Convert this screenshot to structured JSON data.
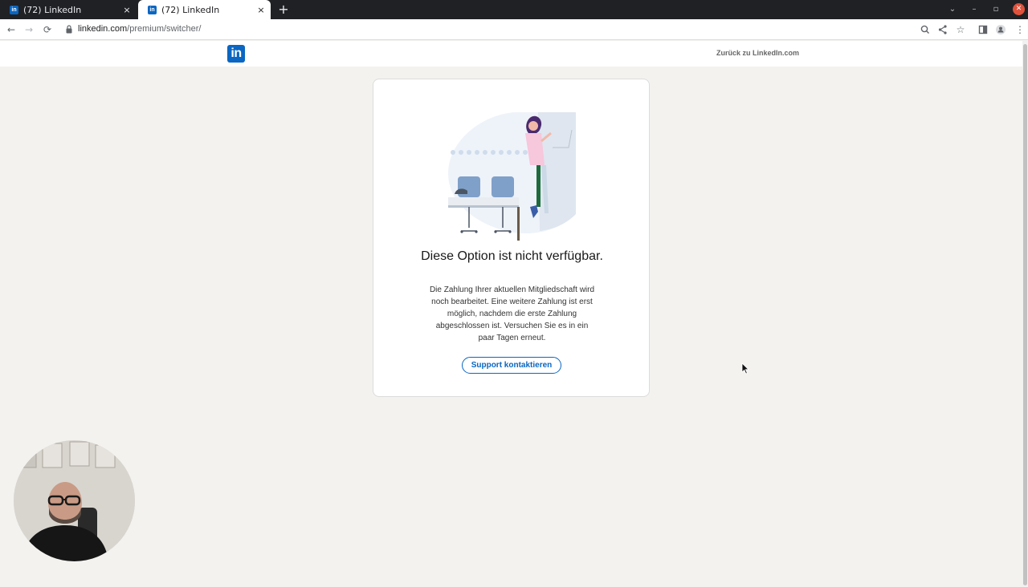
{
  "browser": {
    "tabs": [
      {
        "title": "(72) LinkedIn",
        "favicon": "in",
        "close": "×"
      },
      {
        "title": "(72) LinkedIn",
        "favicon": "in",
        "close": "×"
      }
    ],
    "new_tab": "+",
    "url_domain": "linkedin.com",
    "url_path": "/premium/switcher/"
  },
  "header": {
    "logo": "in",
    "back_link": "Zurück zu LinkedIn.com"
  },
  "dialog": {
    "title": "Diese Option ist nicht verfügbar.",
    "message": "Die Zahlung Ihrer aktuellen Mitgliedschaft wird noch bearbeitet. Eine weitere Zahlung ist erst möglich, nachdem die erste Zahlung abgeschlossen ist. Versuchen Sie es in ein paar Tagen erneut.",
    "support_button": "Support kontaktieren"
  },
  "colors": {
    "brand": "#0a66c2",
    "page_background": "#f3f2ef"
  }
}
